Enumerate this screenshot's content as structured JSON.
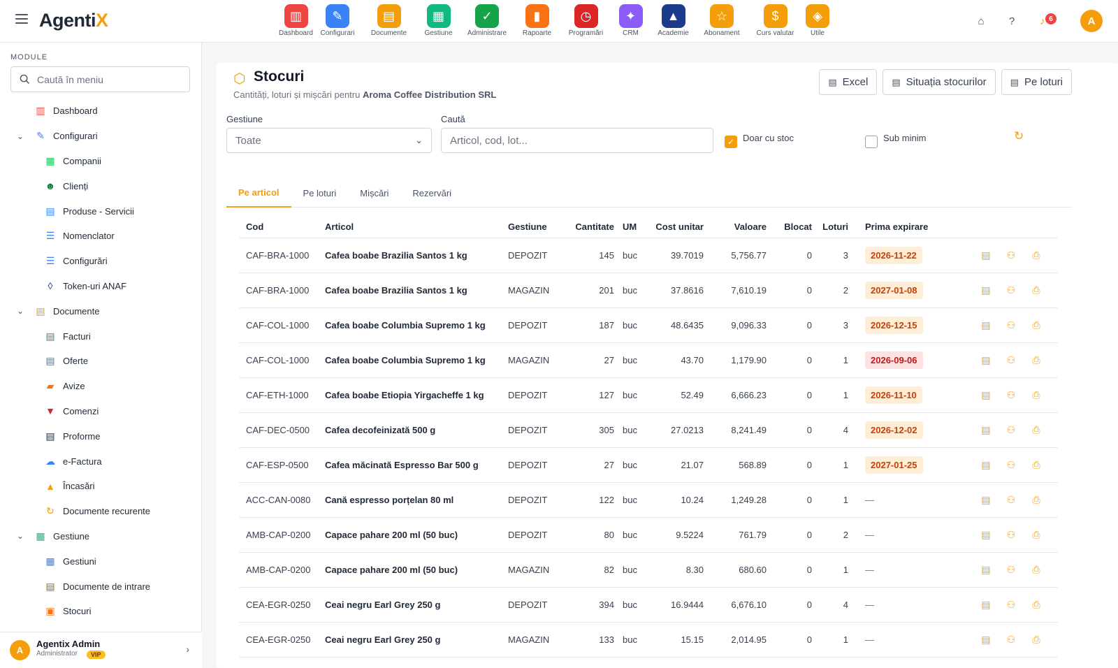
{
  "brand": {
    "name": "Agenti",
    "accent": "X"
  },
  "modules": [
    {
      "label": "Dashboard",
      "icon": "dashboard-icon",
      "color": "#ef4444",
      "glyph": "▥"
    },
    {
      "label": "Configurari",
      "icon": "wrench-icon",
      "color": "#3b82f6",
      "glyph": "✎"
    },
    {
      "label": "Documente",
      "icon": "documents-icon",
      "color": "#f59e0b",
      "glyph": "▤"
    },
    {
      "label": "Gestiune",
      "icon": "books-icon",
      "color": "#10b981",
      "glyph": "▦"
    },
    {
      "label": "Administrare",
      "icon": "shield-icon",
      "color": "#16a34a",
      "glyph": "✓"
    },
    {
      "label": "Rapoarte",
      "icon": "reports-icon",
      "color": "#f97316",
      "glyph": "▮"
    },
    {
      "label": "Programări",
      "icon": "clock-icon",
      "color": "#dc2626",
      "glyph": "◷"
    },
    {
      "label": "CRM",
      "icon": "crm-icon",
      "color": "#8b5cf6",
      "glyph": "✦"
    },
    {
      "label": "Academie",
      "icon": "graduation-icon",
      "color": "#1e3a8a",
      "glyph": "▲"
    },
    {
      "label": "Abonament",
      "icon": "star-icon",
      "color": "#f59e0b",
      "glyph": "☆"
    },
    {
      "label": "Curs valutar",
      "icon": "money-icon",
      "color": "#f59e0b",
      "glyph": "$"
    },
    {
      "label": "Utile",
      "icon": "compass-icon",
      "color": "#f59e0b",
      "glyph": "◈"
    }
  ],
  "topbar": {
    "notif_count": "6",
    "avatar": "A"
  },
  "sidebar": {
    "heading": "MODULE",
    "search_placeholder": "Caută în meniu",
    "items": [
      {
        "label": "Dashboard",
        "level": 1,
        "icon": "dashboard-icon",
        "color": "#ef4444",
        "glyph": "▥"
      },
      {
        "label": "Configurari",
        "level": 1,
        "icon": "wrench-icon",
        "color": "#3b82f6",
        "glyph": "✎",
        "expanded": true
      },
      {
        "label": "Companii",
        "level": 2,
        "icon": "company-icon",
        "color": "#22c55e",
        "glyph": "▦"
      },
      {
        "label": "Clienți",
        "level": 2,
        "icon": "clients-icon",
        "color": "#15803d",
        "glyph": "☻"
      },
      {
        "label": "Produse - Servicii",
        "level": 2,
        "icon": "products-icon",
        "color": "#3b82f6",
        "glyph": "▤"
      },
      {
        "label": "Nomenclator",
        "level": 2,
        "icon": "list-icon",
        "color": "#3b82f6",
        "glyph": "☰"
      },
      {
        "label": "Configurări",
        "level": 2,
        "icon": "settings-list-icon",
        "color": "#3b82f6",
        "glyph": "☰"
      },
      {
        "label": "Token-uri ANAF",
        "level": 2,
        "icon": "shield-icon",
        "color": "#1e3a8a",
        "glyph": "◊"
      },
      {
        "label": "Documente",
        "level": 1,
        "icon": "documents-icon",
        "color": "#f59e0b",
        "glyph": "▤",
        "expanded": true
      },
      {
        "label": "Facturi",
        "level": 2,
        "icon": "invoice-icon",
        "color": "#16a34a",
        "glyph": "▤"
      },
      {
        "label": "Oferte",
        "level": 2,
        "icon": "offer-icon",
        "color": "#64748b",
        "glyph": "▤"
      },
      {
        "label": "Avize",
        "level": 2,
        "icon": "truck-icon",
        "color": "#f97316",
        "glyph": "▰"
      },
      {
        "label": "Comenzi",
        "level": 2,
        "icon": "cart-icon",
        "color": "#dc2626",
        "glyph": "▼"
      },
      {
        "label": "Proforme",
        "level": 2,
        "icon": "proforma-icon",
        "color": "#1f2937",
        "glyph": "▤"
      },
      {
        "label": "e-Factura",
        "level": 2,
        "icon": "cloud-icon",
        "color": "#3b82f6",
        "glyph": "☁"
      },
      {
        "label": "Încasări",
        "level": 2,
        "icon": "chart-up-icon",
        "color": "#f59e0b",
        "glyph": "▲"
      },
      {
        "label": "Documente recurente",
        "level": 2,
        "icon": "recurring-icon",
        "color": "#f59e0b",
        "glyph": "↻"
      },
      {
        "label": "Gestiune",
        "level": 1,
        "icon": "books-icon",
        "color": "#10b981",
        "glyph": "▦",
        "expanded": true
      },
      {
        "label": "Gestiuni",
        "level": 2,
        "icon": "warehouse-icon",
        "color": "#3b82f6",
        "glyph": "▦"
      },
      {
        "label": "Documente de intrare",
        "level": 2,
        "icon": "inbound-icon",
        "color": "#a16207",
        "glyph": "▤"
      },
      {
        "label": "Stocuri",
        "level": 2,
        "icon": "boxes-icon",
        "color": "#f97316",
        "glyph": "▣"
      }
    ],
    "user": {
      "initial": "A",
      "name": "Agentix Admin",
      "role": "Administrator",
      "badge": "VIP"
    }
  },
  "page": {
    "title": "Stocuri",
    "subtitle_prefix": "Cantități, loturi și mișcări pentru",
    "company": "Aroma Coffee Distribution SRL",
    "buttons": {
      "excel": "Excel",
      "situatia": "Situația stocurilor",
      "loturi": "Pe loturi"
    }
  },
  "filters": {
    "gestiune_label": "Gestiune",
    "gestiune_value": "Toate",
    "search_label": "Caută",
    "search_placeholder": "Articol, cod, lot...",
    "only_stock_label": "Doar cu stoc",
    "only_stock_checked": true,
    "below_min_label": "Sub minim",
    "below_min_checked": false
  },
  "tabs": [
    "Pe articol",
    "Pe loturi",
    "Mișcări",
    "Rezervări"
  ],
  "active_tab": 0,
  "table": {
    "columns": [
      "Cod",
      "Articol",
      "Gestiune",
      "Cantitate",
      "UM",
      "Cost unitar",
      "Valoare",
      "Blocat",
      "Loturi",
      "Prima expirare"
    ],
    "rows": [
      {
        "cod": "CAF-BRA-1000",
        "articol": "Cafea boabe Brazilia Santos 1 kg",
        "gestiune": "DEPOZIT",
        "cantitate": "145",
        "um": "buc",
        "cost": "39.7019",
        "valoare": "5,756.77",
        "blocat": "0",
        "loturi": "3",
        "expirare": "2026-11-22",
        "urgent": false
      },
      {
        "cod": "CAF-BRA-1000",
        "articol": "Cafea boabe Brazilia Santos 1 kg",
        "gestiune": "MAGAZIN",
        "cantitate": "201",
        "um": "buc",
        "cost": "37.8616",
        "valoare": "7,610.19",
        "blocat": "0",
        "loturi": "2",
        "expirare": "2027-01-08",
        "urgent": false
      },
      {
        "cod": "CAF-COL-1000",
        "articol": "Cafea boabe Columbia Supremo 1 kg",
        "gestiune": "DEPOZIT",
        "cantitate": "187",
        "um": "buc",
        "cost": "48.6435",
        "valoare": "9,096.33",
        "blocat": "0",
        "loturi": "3",
        "expirare": "2026-12-15",
        "urgent": false
      },
      {
        "cod": "CAF-COL-1000",
        "articol": "Cafea boabe Columbia Supremo 1 kg",
        "gestiune": "MAGAZIN",
        "cantitate": "27",
        "um": "buc",
        "cost": "43.70",
        "valoare": "1,179.90",
        "blocat": "0",
        "loturi": "1",
        "expirare": "2026-09-06",
        "urgent": true
      },
      {
        "cod": "CAF-ETH-1000",
        "articol": "Cafea boabe Etiopia Yirgacheffe 1 kg",
        "gestiune": "DEPOZIT",
        "cantitate": "127",
        "um": "buc",
        "cost": "52.49",
        "valoare": "6,666.23",
        "blocat": "0",
        "loturi": "1",
        "expirare": "2026-11-10",
        "urgent": false
      },
      {
        "cod": "CAF-DEC-0500",
        "articol": "Cafea decofeinizată 500 g",
        "gestiune": "DEPOZIT",
        "cantitate": "305",
        "um": "buc",
        "cost": "27.0213",
        "valoare": "8,241.49",
        "blocat": "0",
        "loturi": "4",
        "expirare": "2026-12-02",
        "urgent": false
      },
      {
        "cod": "CAF-ESP-0500",
        "articol": "Cafea măcinată Espresso Bar 500 g",
        "gestiune": "DEPOZIT",
        "cantitate": "27",
        "um": "buc",
        "cost": "21.07",
        "valoare": "568.89",
        "blocat": "0",
        "loturi": "1",
        "expirare": "2027-01-25",
        "urgent": false
      },
      {
        "cod": "ACC-CAN-0080",
        "articol": "Cană espresso porțelan 80 ml",
        "gestiune": "DEPOZIT",
        "cantitate": "122",
        "um": "buc",
        "cost": "10.24",
        "valoare": "1,249.28",
        "blocat": "0",
        "loturi": "1",
        "expirare": "—",
        "urgent": false
      },
      {
        "cod": "AMB-CAP-0200",
        "articol": "Capace pahare 200 ml (50 buc)",
        "gestiune": "DEPOZIT",
        "cantitate": "80",
        "um": "buc",
        "cost": "9.5224",
        "valoare": "761.79",
        "blocat": "0",
        "loturi": "2",
        "expirare": "—",
        "urgent": false
      },
      {
        "cod": "AMB-CAP-0200",
        "articol": "Capace pahare 200 ml (50 buc)",
        "gestiune": "MAGAZIN",
        "cantitate": "82",
        "um": "buc",
        "cost": "8.30",
        "valoare": "680.60",
        "blocat": "0",
        "loturi": "1",
        "expirare": "—",
        "urgent": false
      },
      {
        "cod": "CEA-EGR-0250",
        "articol": "Ceai negru Earl Grey 250 g",
        "gestiune": "DEPOZIT",
        "cantitate": "394",
        "um": "buc",
        "cost": "16.9444",
        "valoare": "6,676.10",
        "blocat": "0",
        "loturi": "4",
        "expirare": "—",
        "urgent": false
      },
      {
        "cod": "CEA-EGR-0250",
        "articol": "Ceai negru Earl Grey 250 g",
        "gestiune": "MAGAZIN",
        "cantitate": "133",
        "um": "buc",
        "cost": "15.15",
        "valoare": "2,014.95",
        "blocat": "0",
        "loturi": "1",
        "expirare": "—",
        "urgent": false
      }
    ]
  }
}
